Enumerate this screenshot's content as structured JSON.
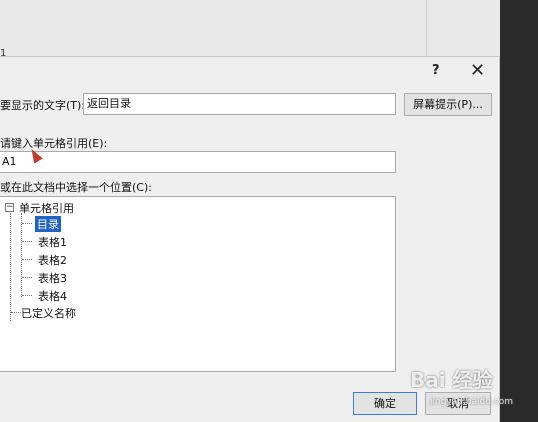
{
  "background": {
    "row_number": "1"
  },
  "dialog": {
    "help_label": "?",
    "close_label": "✕",
    "display_text_label": "要显示的文字(T):",
    "display_text_value": "返回目录",
    "screentip_button": "屏幕提示(P)...",
    "cell_ref_label": "请键入单元格引用(E):",
    "cell_ref_value": "A1",
    "location_label": "或在此文档中选择一个位置(C):",
    "tree": {
      "root": "单元格引用",
      "expander": "−",
      "children": [
        "目录",
        "表格1",
        "表格2",
        "表格3",
        "表格4"
      ],
      "selected": "目录",
      "defined_names": "已定义名称"
    },
    "ok_button": "确定",
    "cancel_button": "取消"
  },
  "watermark": {
    "text": "Bai 经验",
    "subtext": "jingyan.baidu.com"
  }
}
